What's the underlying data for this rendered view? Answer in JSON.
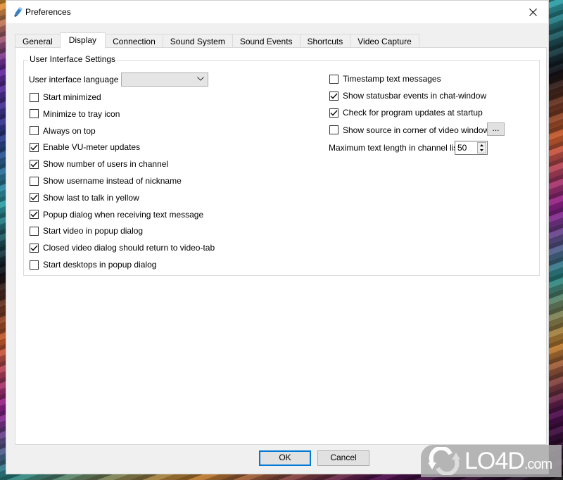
{
  "window": {
    "title": "Preferences",
    "icon": "pen-icon",
    "close_icon": "close-icon"
  },
  "tabs": [
    {
      "label": "General",
      "active": false
    },
    {
      "label": "Display",
      "active": true
    },
    {
      "label": "Connection",
      "active": false
    },
    {
      "label": "Sound System",
      "active": false
    },
    {
      "label": "Sound Events",
      "active": false
    },
    {
      "label": "Shortcuts",
      "active": false
    },
    {
      "label": "Video Capture",
      "active": false
    }
  ],
  "group": {
    "label": "User Interface Settings",
    "language_label": "User interface language",
    "language_value": "",
    "left_options": [
      {
        "label": "Start minimized",
        "checked": false
      },
      {
        "label": "Minimize to tray icon",
        "checked": false
      },
      {
        "label": "Always on top",
        "checked": false
      },
      {
        "label": "Enable VU-meter updates",
        "checked": true
      },
      {
        "label": "Show number of users in channel",
        "checked": true
      },
      {
        "label": "Show username instead of nickname",
        "checked": false
      },
      {
        "label": "Show last to talk in yellow",
        "checked": true
      },
      {
        "label": "Popup dialog when receiving text message",
        "checked": true
      },
      {
        "label": "Start video in popup dialog",
        "checked": false
      },
      {
        "label": "Closed video dialog should return to video-tab",
        "checked": true
      },
      {
        "label": "Start desktops in popup dialog",
        "checked": false
      }
    ],
    "right_options": [
      {
        "label": "Timestamp text messages",
        "checked": false
      },
      {
        "label": "Show statusbar events in chat-window",
        "checked": true
      },
      {
        "label": "Check for program updates at startup",
        "checked": true
      },
      {
        "label": "Show source in corner of video window",
        "checked": false
      }
    ],
    "ellipsis_label": "...",
    "max_text_label": "Maximum text length in channel list",
    "max_text_value": "50"
  },
  "buttons": {
    "ok": "OK",
    "cancel": "Cancel"
  },
  "watermark": {
    "text": "LO4D",
    "suffix": ".com"
  }
}
